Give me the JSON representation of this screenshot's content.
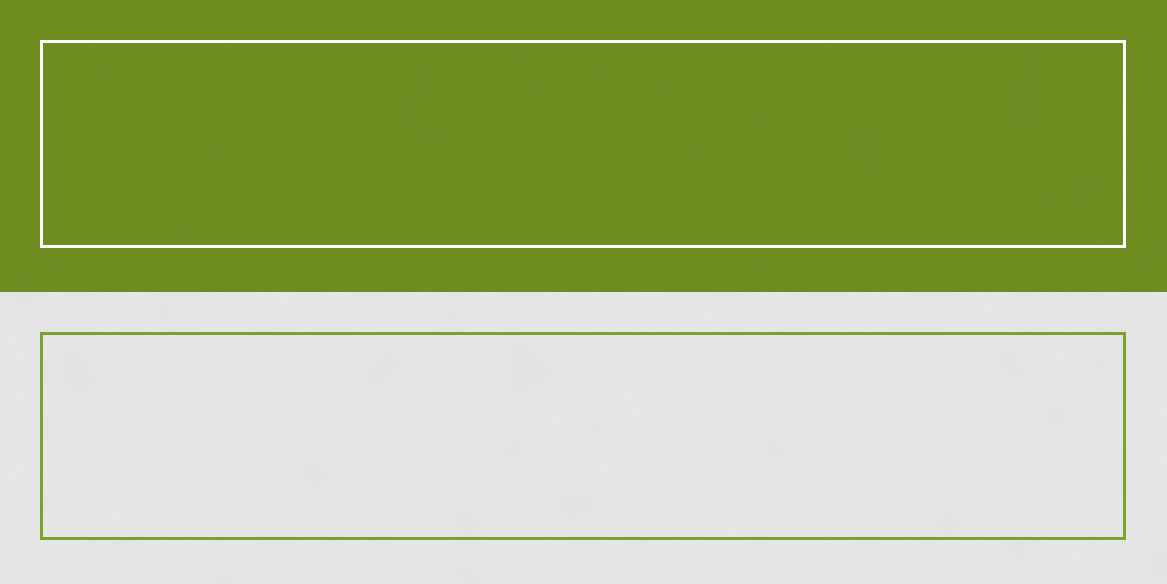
{
  "swatches": [
    {
      "name": "green-felt-panel",
      "background_color": "#6e931c",
      "frame_color": "#ffffff"
    },
    {
      "name": "white-paper-panel",
      "background_color": "#ececec",
      "frame_color": "#7aa32a"
    }
  ]
}
